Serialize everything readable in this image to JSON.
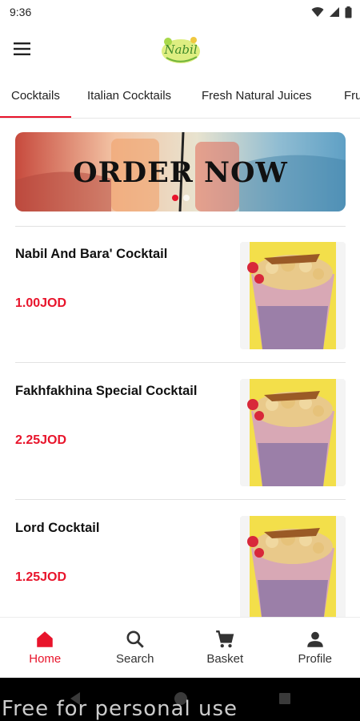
{
  "status": {
    "time": "9:36"
  },
  "app": {
    "logo_text": "Nabil"
  },
  "tabs": [
    {
      "label": "Cocktails",
      "active": true
    },
    {
      "label": "Italian Cocktails"
    },
    {
      "label": "Fresh Natural Juices"
    },
    {
      "label": "Fru"
    }
  ],
  "banner": {
    "title": "ORDER NOW",
    "slides": 2,
    "active_slide": 0
  },
  "items": [
    {
      "name": "Nabil And Bara' Cocktail",
      "price": "1.00JOD"
    },
    {
      "name": "Fakhfakhina Special Cocktail",
      "price": "2.25JOD"
    },
    {
      "name": "Lord Cocktail",
      "price": "1.25JOD"
    }
  ],
  "bottom_nav": [
    {
      "label": "Home",
      "icon": "home-icon",
      "active": true
    },
    {
      "label": "Search",
      "icon": "search-icon"
    },
    {
      "label": "Basket",
      "icon": "cart-icon"
    },
    {
      "label": "Profile",
      "icon": "person-icon"
    }
  ],
  "watermark": "Free for personal use",
  "colors": {
    "accent": "#e8142b",
    "price": "#e8142b",
    "system_nav": "#000000"
  }
}
